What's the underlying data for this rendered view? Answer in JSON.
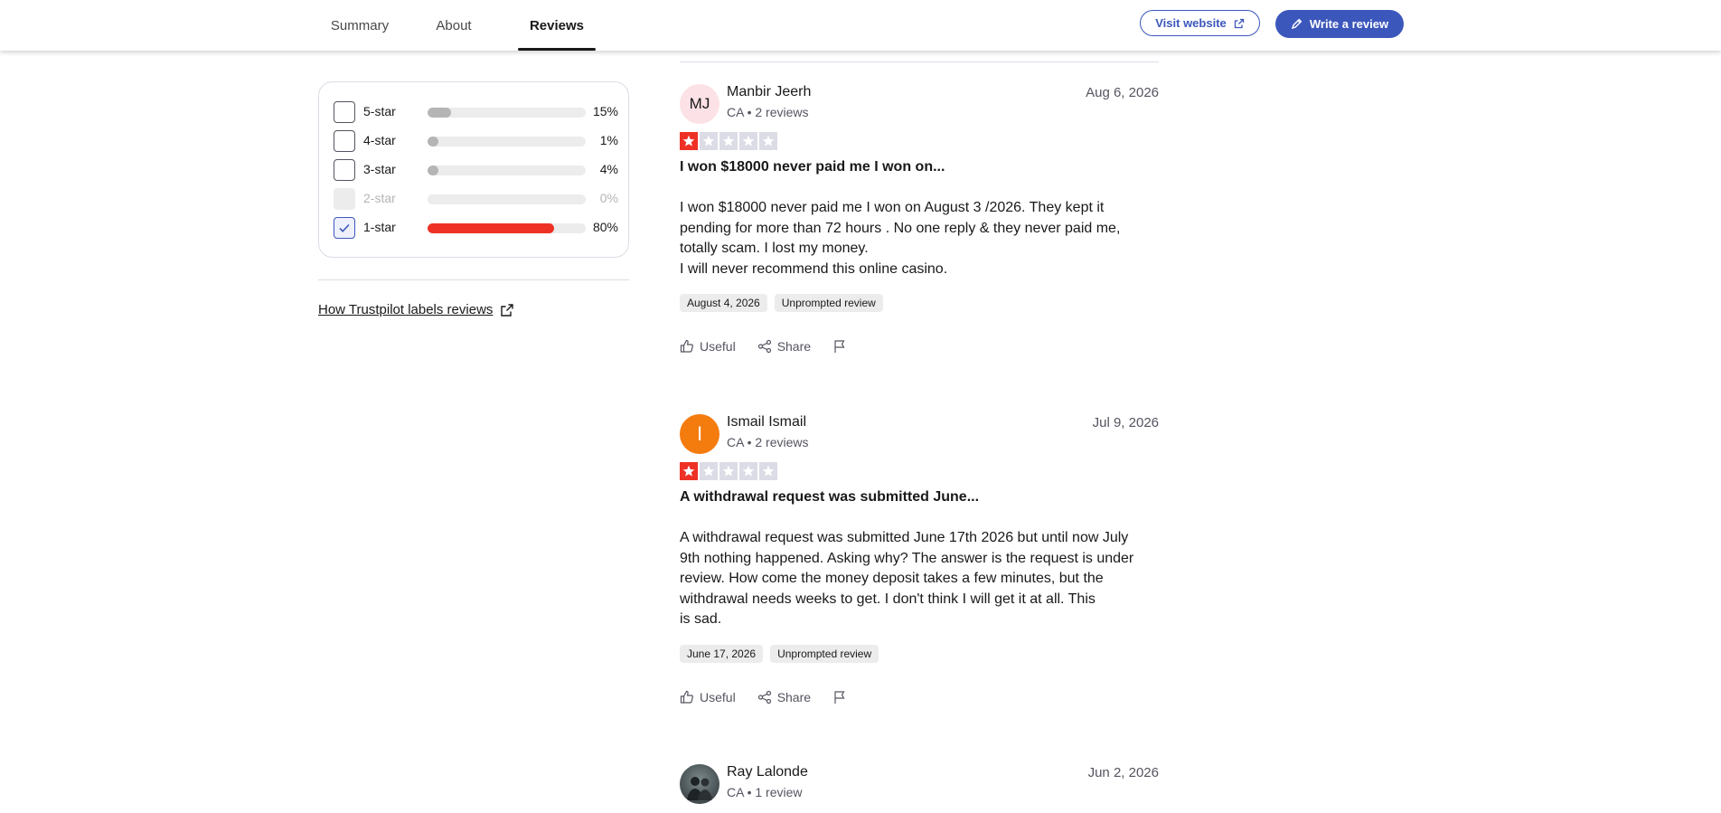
{
  "tabs": [
    "Summary",
    "About",
    "Reviews"
  ],
  "header": {
    "visit_label": "Visit website",
    "write_label": "Write a review"
  },
  "filters": [
    {
      "label": "5-star",
      "percent": "15%",
      "value": 15,
      "checked": false,
      "disabled": false
    },
    {
      "label": "4-star",
      "percent": "1%",
      "value": 1,
      "checked": false,
      "disabled": false
    },
    {
      "label": "3-star",
      "percent": "4%",
      "value": 4,
      "checked": false,
      "disabled": false
    },
    {
      "label": "2-star",
      "percent": "0%",
      "value": 0,
      "checked": false,
      "disabled": true
    },
    {
      "label": "1-star",
      "percent": "80%",
      "value": 80,
      "checked": true,
      "disabled": false
    }
  ],
  "labels_link": "How Trustpilot labels reviews",
  "actions": {
    "useful": "Useful",
    "share": "Share"
  },
  "reviews": [
    {
      "initials": "MJ",
      "name": "Manbir Jeerh",
      "meta": "CA • 2 reviews",
      "date": "Aug 6, 2026",
      "stars": 1,
      "title": "I won $18000 never paid me I won on...",
      "body": [
        "I won $18000 never paid me I won on August 3 /2026. They kept it",
        "pending for more than 72 hours . No one reply & they never paid me,",
        "totally scam. I lost my money.",
        "I will never recommend this online casino."
      ],
      "experience_date": "August 4, 2026",
      "tag": "Unprompted review"
    },
    {
      "initials": "I",
      "name": "Ismail Ismail",
      "meta": "CA • 2 reviews",
      "date": "Jul 9, 2026",
      "stars": 1,
      "title": "A withdrawal request was submitted June...",
      "body": [
        "A withdrawal request was submitted June 17th 2026 but until now July",
        "9th nothing happened. Asking why? The answer is the request is under",
        "review. How come the money deposit takes a few minutes, but the",
        "withdrawal needs weeks to get. I don't think I will get it at all. This",
        "is sad."
      ],
      "experience_date": "June 17, 2026",
      "tag": "Unprompted review"
    },
    {
      "name": "Ray Lalonde",
      "meta": "CA • 1 review",
      "date": "Jun 2, 2026"
    }
  ]
}
